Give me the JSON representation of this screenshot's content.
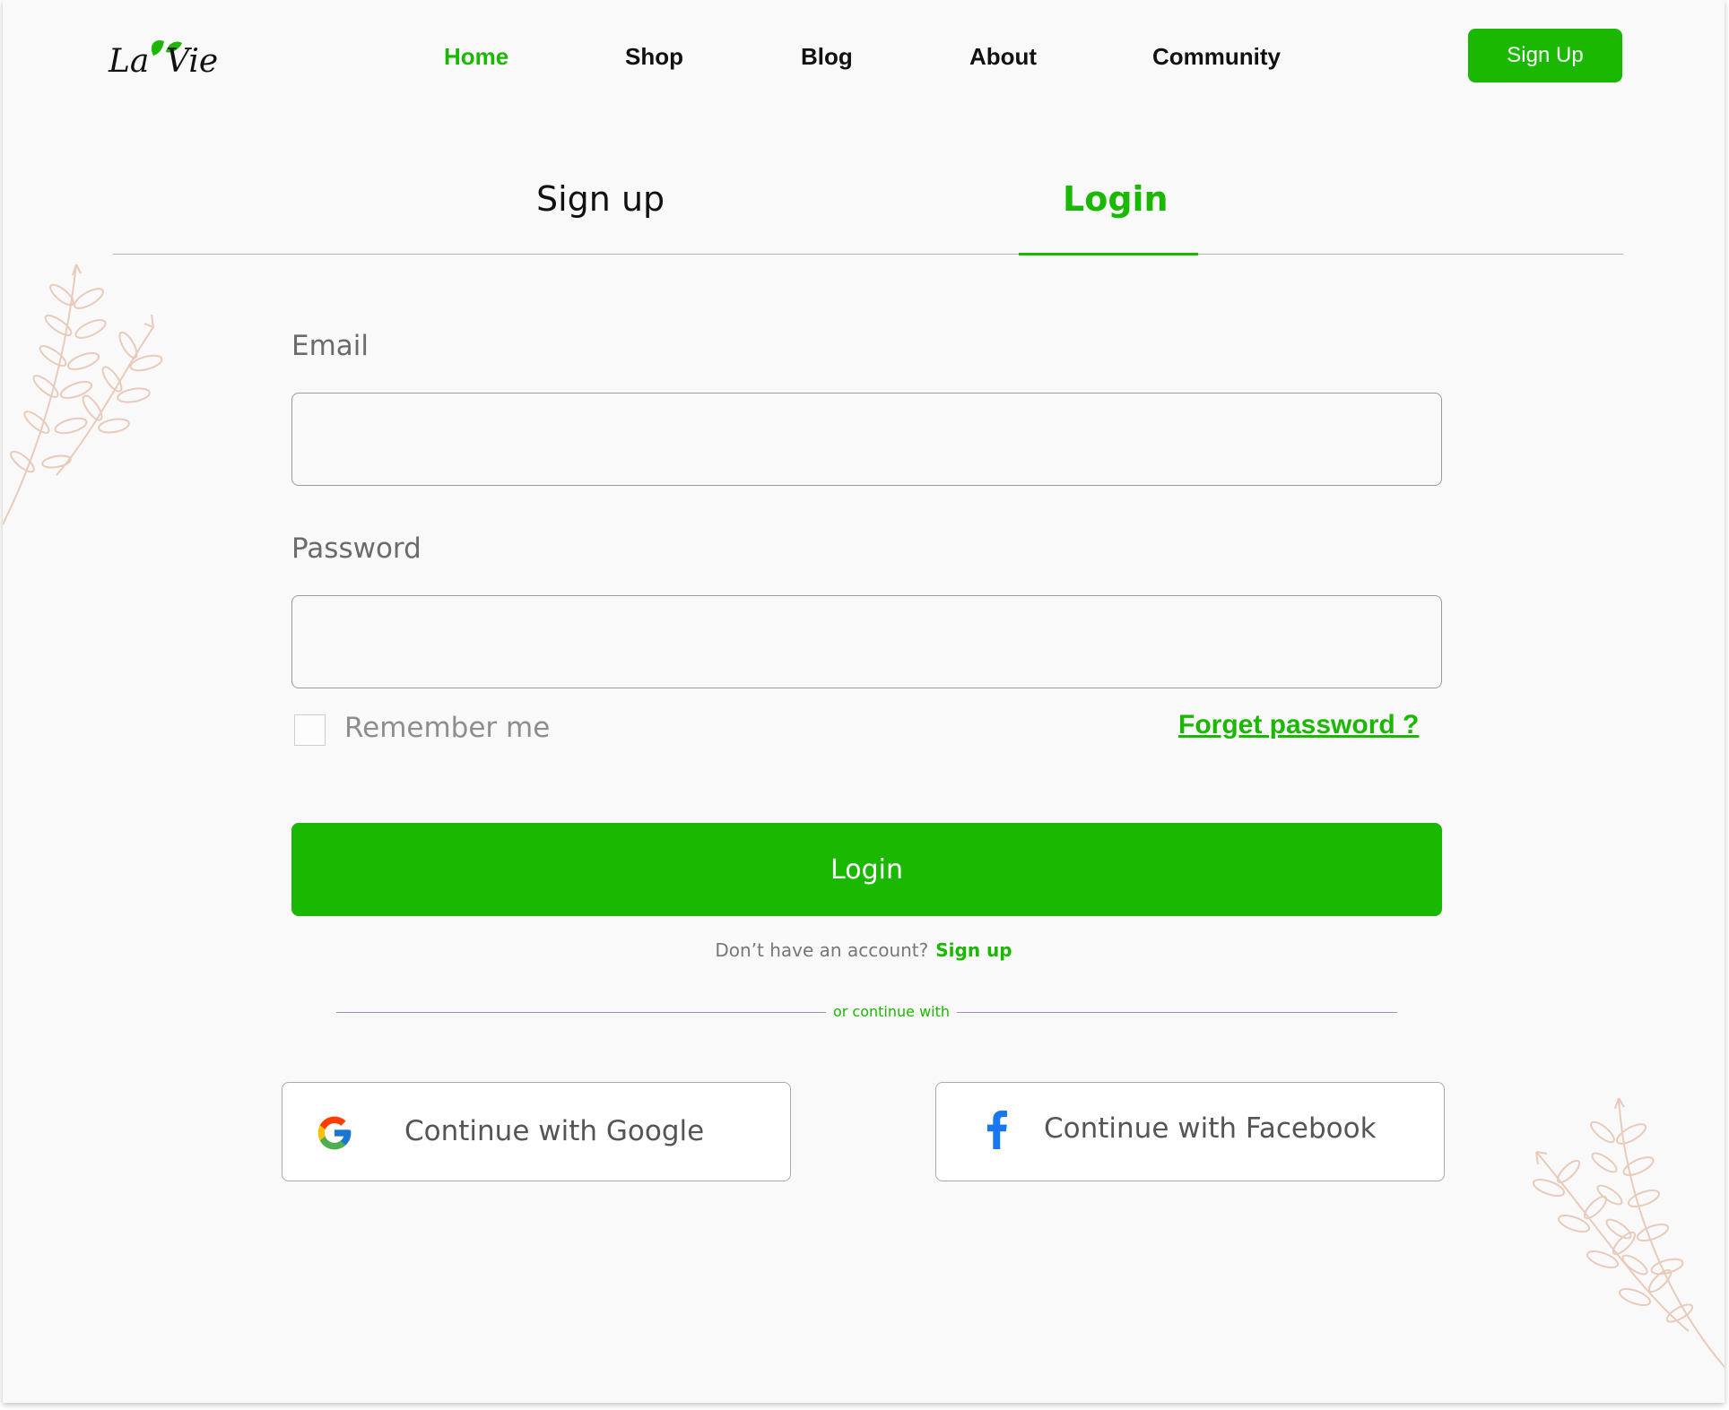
{
  "header": {
    "logo_text": "La Vie",
    "nav": [
      {
        "label": "Home",
        "active": true
      },
      {
        "label": "Shop",
        "active": false
      },
      {
        "label": "Blog",
        "active": false
      },
      {
        "label": "About",
        "active": false
      },
      {
        "label": "Community",
        "active": false
      }
    ],
    "signup_button": "Sign Up"
  },
  "tabs": {
    "signup": "Sign up",
    "login": "Login",
    "active": "login"
  },
  "form": {
    "email_label": "Email",
    "email_value": "",
    "password_label": "Password",
    "password_value": "",
    "remember_label": "Remember me",
    "remember_checked": false,
    "forgot_link": "Forget password ?",
    "login_button": "Login",
    "no_account_text": "Don’t have an account?",
    "signup_link": "Sign up",
    "divider_text": "or continue with"
  },
  "social": {
    "google_label": "Continue with Google",
    "facebook_label": "Continue with Facebook"
  },
  "colors": {
    "accent": "#1bb802",
    "background": "#f9f9f9",
    "leaf": "#e8cbbb",
    "facebook": "#1877f2"
  },
  "icons": [
    "logo-leaf-icon",
    "google-icon",
    "facebook-icon",
    "decorative-leaf-icon"
  ]
}
